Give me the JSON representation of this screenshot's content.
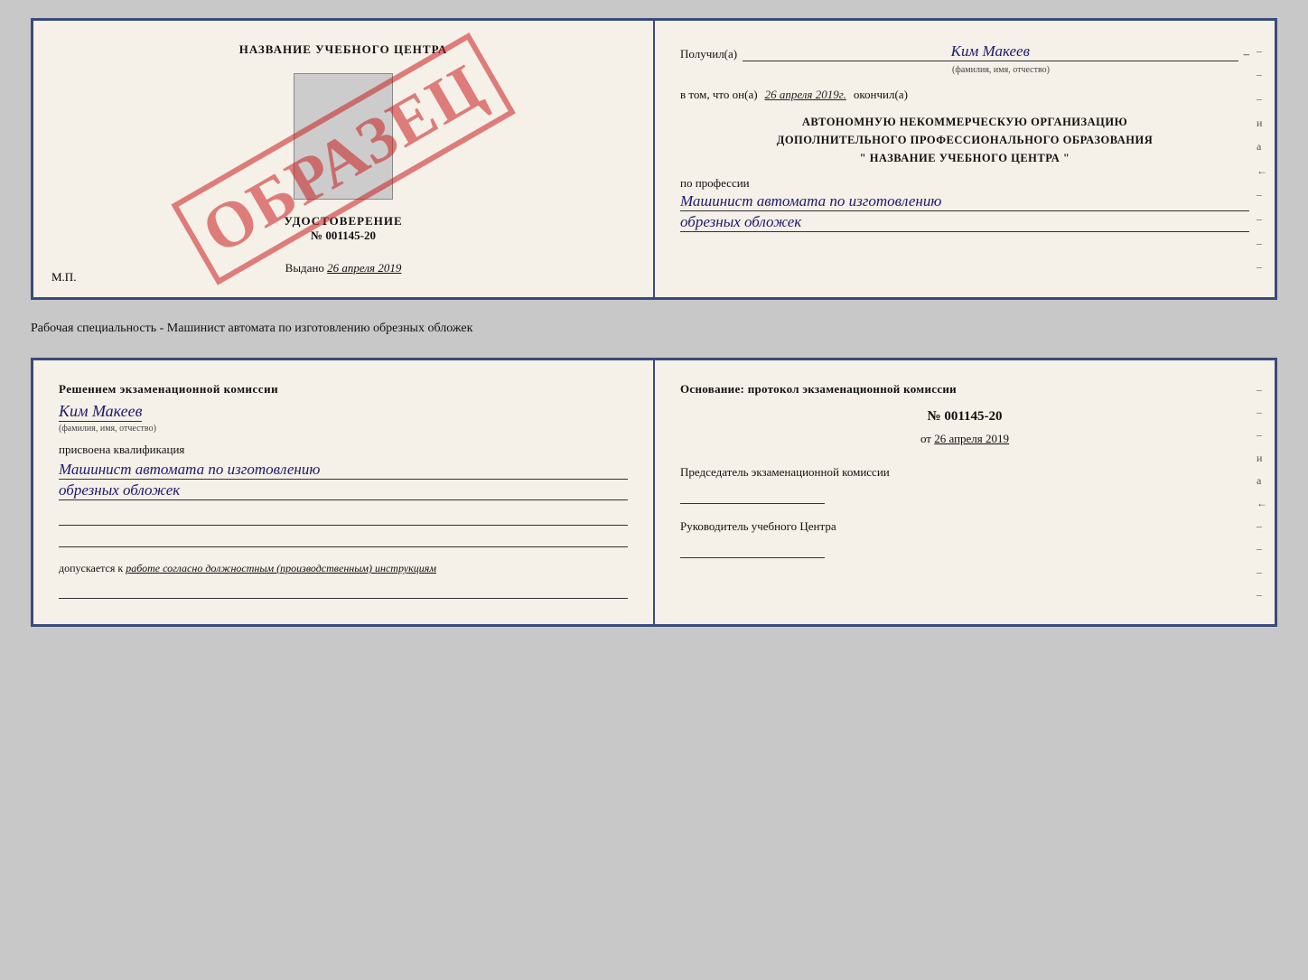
{
  "top_doc": {
    "left": {
      "center_title": "НАЗВАНИЕ УЧЕБНОГО ЦЕНТРА",
      "udost_label": "УДОСТОВЕРЕНИЕ",
      "udost_number": "№ 001145-20",
      "vydano": "Выдано",
      "vydano_date": "26 апреля 2019",
      "mp": "М.П.",
      "obrazec": "ОБРАЗЕЦ"
    },
    "right": {
      "poluchil": "Получил(а)",
      "name": "Ким Макеев",
      "dash": "–",
      "fio_hint": "(фамилия, имя, отчество)",
      "vtom": "в том, что он(а)",
      "date": "26 апреля 2019г.",
      "okoncil": "окончил(а)",
      "org_line1": "АВТОНОМНУЮ НЕКОММЕРЧЕСКУЮ ОРГАНИЗАЦИЮ",
      "org_line2": "ДОПОЛНИТЕЛЬНОГО ПРОФЕССИОНАЛЬНОГО ОБРАЗОВАНИЯ",
      "org_line3": "\"  НАЗВАНИЕ УЧЕБНОГО ЦЕНТРА  \"",
      "po_professii": "по профессии",
      "profession1": "Машинист автомата по изготовлению",
      "profession2": "обрезных обложек"
    }
  },
  "middle_label": "Рабочая специальность - Машинист автомата по изготовлению обрезных обложек",
  "bottom_doc": {
    "left": {
      "resheniem": "Решением экзаменационной комиссии",
      "name": "Ким Макеев",
      "fio_hint": "(фамилия, имя, отчество)",
      "prisvoena": "присвоена квалификация",
      "kvalif1": "Машинист автомата по изготовлению",
      "kvalif2": "обрезных обложек",
      "dopuskaetsya": "допускается к",
      "dopusk_text": "работе согласно должностным (производственным) инструкциям"
    },
    "right": {
      "osnovanie": "Основание: протокол экзаменационной комиссии",
      "number": "№ 001145-20",
      "ot_prefix": "от",
      "date": "26 апреля 2019",
      "predsedatel": "Председатель экзаменационной комиссии",
      "rukovoditel": "Руководитель учебного Центра"
    }
  },
  "dashes": [
    "-",
    "-",
    "-",
    "и",
    "а",
    "←",
    "-",
    "-",
    "-",
    "-"
  ]
}
